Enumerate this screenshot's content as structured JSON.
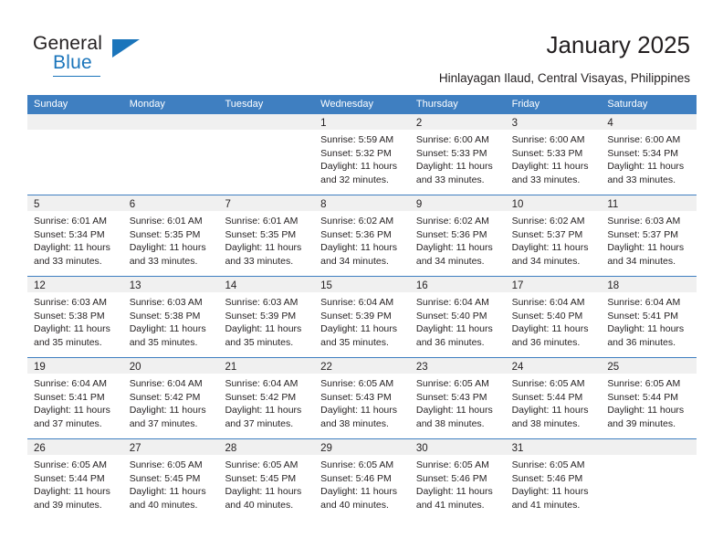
{
  "logo": {
    "word1": "General",
    "word2": "Blue",
    "triangle_color": "#1b75bb"
  },
  "header": {
    "title": "January 2025",
    "location": "Hinlayagan Ilaud, Central Visayas, Philippines"
  },
  "theme": {
    "header_blue": "#3f7fc1",
    "band_gray": "#f0f0f0",
    "text": "#231f20"
  },
  "calendar": {
    "day_headers": [
      "Sunday",
      "Monday",
      "Tuesday",
      "Wednesday",
      "Thursday",
      "Friday",
      "Saturday"
    ],
    "weeks": [
      [
        {
          "day": "",
          "lines": []
        },
        {
          "day": "",
          "lines": []
        },
        {
          "day": "",
          "lines": []
        },
        {
          "day": "1",
          "lines": [
            "Sunrise: 5:59 AM",
            "Sunset: 5:32 PM",
            "Daylight: 11 hours",
            "and 32 minutes."
          ]
        },
        {
          "day": "2",
          "lines": [
            "Sunrise: 6:00 AM",
            "Sunset: 5:33 PM",
            "Daylight: 11 hours",
            "and 33 minutes."
          ]
        },
        {
          "day": "3",
          "lines": [
            "Sunrise: 6:00 AM",
            "Sunset: 5:33 PM",
            "Daylight: 11 hours",
            "and 33 minutes."
          ]
        },
        {
          "day": "4",
          "lines": [
            "Sunrise: 6:00 AM",
            "Sunset: 5:34 PM",
            "Daylight: 11 hours",
            "and 33 minutes."
          ]
        }
      ],
      [
        {
          "day": "5",
          "lines": [
            "Sunrise: 6:01 AM",
            "Sunset: 5:34 PM",
            "Daylight: 11 hours",
            "and 33 minutes."
          ]
        },
        {
          "day": "6",
          "lines": [
            "Sunrise: 6:01 AM",
            "Sunset: 5:35 PM",
            "Daylight: 11 hours",
            "and 33 minutes."
          ]
        },
        {
          "day": "7",
          "lines": [
            "Sunrise: 6:01 AM",
            "Sunset: 5:35 PM",
            "Daylight: 11 hours",
            "and 33 minutes."
          ]
        },
        {
          "day": "8",
          "lines": [
            "Sunrise: 6:02 AM",
            "Sunset: 5:36 PM",
            "Daylight: 11 hours",
            "and 34 minutes."
          ]
        },
        {
          "day": "9",
          "lines": [
            "Sunrise: 6:02 AM",
            "Sunset: 5:36 PM",
            "Daylight: 11 hours",
            "and 34 minutes."
          ]
        },
        {
          "day": "10",
          "lines": [
            "Sunrise: 6:02 AM",
            "Sunset: 5:37 PM",
            "Daylight: 11 hours",
            "and 34 minutes."
          ]
        },
        {
          "day": "11",
          "lines": [
            "Sunrise: 6:03 AM",
            "Sunset: 5:37 PM",
            "Daylight: 11 hours",
            "and 34 minutes."
          ]
        }
      ],
      [
        {
          "day": "12",
          "lines": [
            "Sunrise: 6:03 AM",
            "Sunset: 5:38 PM",
            "Daylight: 11 hours",
            "and 35 minutes."
          ]
        },
        {
          "day": "13",
          "lines": [
            "Sunrise: 6:03 AM",
            "Sunset: 5:38 PM",
            "Daylight: 11 hours",
            "and 35 minutes."
          ]
        },
        {
          "day": "14",
          "lines": [
            "Sunrise: 6:03 AM",
            "Sunset: 5:39 PM",
            "Daylight: 11 hours",
            "and 35 minutes."
          ]
        },
        {
          "day": "15",
          "lines": [
            "Sunrise: 6:04 AM",
            "Sunset: 5:39 PM",
            "Daylight: 11 hours",
            "and 35 minutes."
          ]
        },
        {
          "day": "16",
          "lines": [
            "Sunrise: 6:04 AM",
            "Sunset: 5:40 PM",
            "Daylight: 11 hours",
            "and 36 minutes."
          ]
        },
        {
          "day": "17",
          "lines": [
            "Sunrise: 6:04 AM",
            "Sunset: 5:40 PM",
            "Daylight: 11 hours",
            "and 36 minutes."
          ]
        },
        {
          "day": "18",
          "lines": [
            "Sunrise: 6:04 AM",
            "Sunset: 5:41 PM",
            "Daylight: 11 hours",
            "and 36 minutes."
          ]
        }
      ],
      [
        {
          "day": "19",
          "lines": [
            "Sunrise: 6:04 AM",
            "Sunset: 5:41 PM",
            "Daylight: 11 hours",
            "and 37 minutes."
          ]
        },
        {
          "day": "20",
          "lines": [
            "Sunrise: 6:04 AM",
            "Sunset: 5:42 PM",
            "Daylight: 11 hours",
            "and 37 minutes."
          ]
        },
        {
          "day": "21",
          "lines": [
            "Sunrise: 6:04 AM",
            "Sunset: 5:42 PM",
            "Daylight: 11 hours",
            "and 37 minutes."
          ]
        },
        {
          "day": "22",
          "lines": [
            "Sunrise: 6:05 AM",
            "Sunset: 5:43 PM",
            "Daylight: 11 hours",
            "and 38 minutes."
          ]
        },
        {
          "day": "23",
          "lines": [
            "Sunrise: 6:05 AM",
            "Sunset: 5:43 PM",
            "Daylight: 11 hours",
            "and 38 minutes."
          ]
        },
        {
          "day": "24",
          "lines": [
            "Sunrise: 6:05 AM",
            "Sunset: 5:44 PM",
            "Daylight: 11 hours",
            "and 38 minutes."
          ]
        },
        {
          "day": "25",
          "lines": [
            "Sunrise: 6:05 AM",
            "Sunset: 5:44 PM",
            "Daylight: 11 hours",
            "and 39 minutes."
          ]
        }
      ],
      [
        {
          "day": "26",
          "lines": [
            "Sunrise: 6:05 AM",
            "Sunset: 5:44 PM",
            "Daylight: 11 hours",
            "and 39 minutes."
          ]
        },
        {
          "day": "27",
          "lines": [
            "Sunrise: 6:05 AM",
            "Sunset: 5:45 PM",
            "Daylight: 11 hours",
            "and 40 minutes."
          ]
        },
        {
          "day": "28",
          "lines": [
            "Sunrise: 6:05 AM",
            "Sunset: 5:45 PM",
            "Daylight: 11 hours",
            "and 40 minutes."
          ]
        },
        {
          "day": "29",
          "lines": [
            "Sunrise: 6:05 AM",
            "Sunset: 5:46 PM",
            "Daylight: 11 hours",
            "and 40 minutes."
          ]
        },
        {
          "day": "30",
          "lines": [
            "Sunrise: 6:05 AM",
            "Sunset: 5:46 PM",
            "Daylight: 11 hours",
            "and 41 minutes."
          ]
        },
        {
          "day": "31",
          "lines": [
            "Sunrise: 6:05 AM",
            "Sunset: 5:46 PM",
            "Daylight: 11 hours",
            "and 41 minutes."
          ]
        },
        {
          "day": "",
          "lines": []
        }
      ]
    ]
  }
}
